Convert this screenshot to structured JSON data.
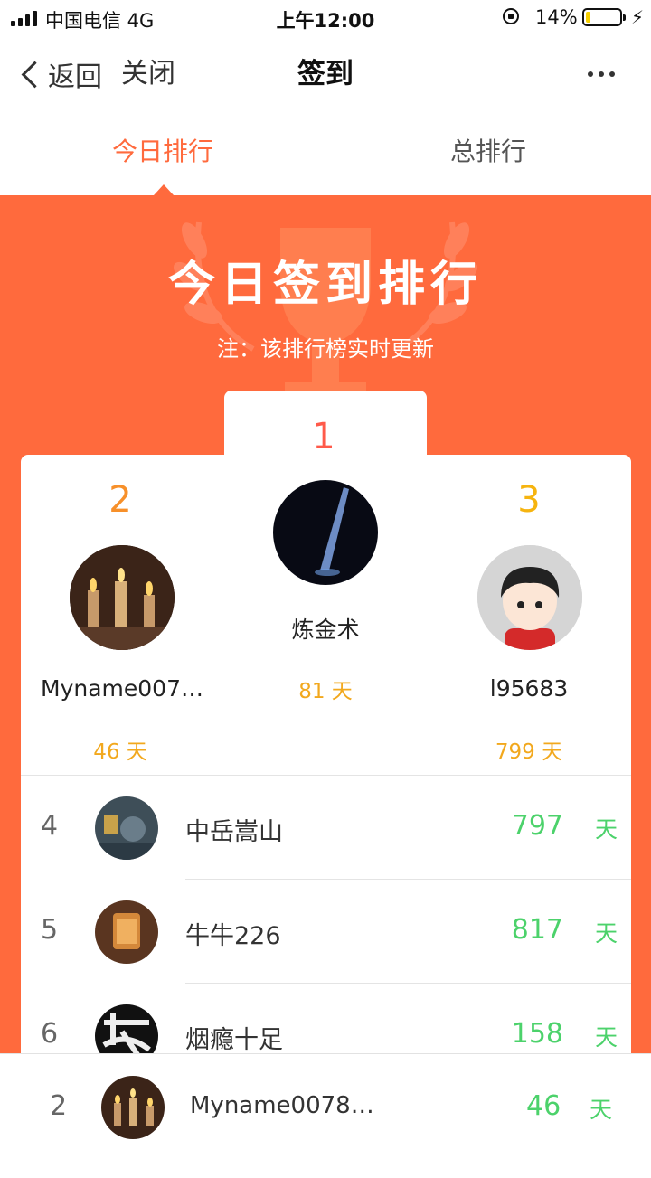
{
  "status_bar": {
    "carrier": "中国电信   4G",
    "time": "上午12:00",
    "battery_percent": "14%",
    "battery_level": 0.14
  },
  "nav": {
    "back_label": "返回",
    "close_label": "关闭",
    "title": "签到"
  },
  "tabs": [
    {
      "label": "今日排行",
      "active": true
    },
    {
      "label": "总排行",
      "active": false
    }
  ],
  "hero": {
    "title": "今日签到排行",
    "note": "注：该排行榜实时更新"
  },
  "podium": {
    "first": {
      "rank": "1",
      "name": "炼金术",
      "days": "81 天"
    },
    "second": {
      "rank": "2",
      "name": "Myname007…",
      "days": "46 天"
    },
    "third": {
      "rank": "3",
      "name": "l95683",
      "days": "799 天"
    }
  },
  "list": [
    {
      "rank": "4",
      "name": "中岳嵩山",
      "days": "797",
      "unit": "天"
    },
    {
      "rank": "5",
      "name": "牛牛226",
      "days": "817",
      "unit": "天"
    },
    {
      "rank": "6",
      "name": "烟瘾十足",
      "days": "158",
      "unit": "天"
    }
  ],
  "my_rank": {
    "rank": "2",
    "name": "Myname0078…",
    "days": "46",
    "unit": "天"
  },
  "colors": {
    "accent": "#ff6a3d",
    "gold": "#f2a81d",
    "green": "#4cd26b",
    "rank_first": "#ff5a4a"
  }
}
